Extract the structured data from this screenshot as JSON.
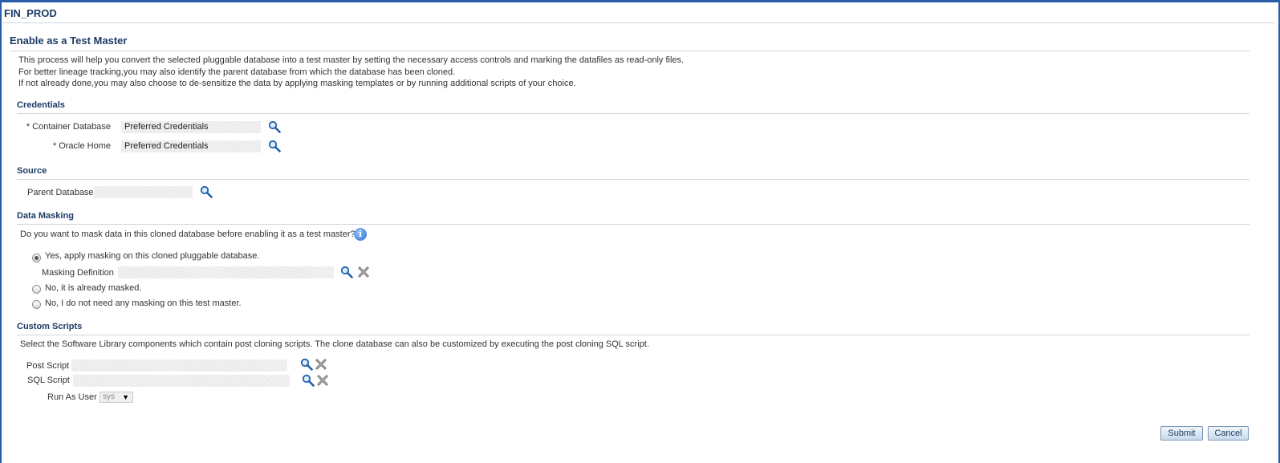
{
  "page": {
    "title": "FIN_PROD"
  },
  "section": {
    "heading": "Enable as a Test Master"
  },
  "intro": {
    "line1": "This process will help you convert the selected pluggable database into a test master by setting the necessary access controls and marking the datafiles as read-only files.",
    "line2": "For better lineage tracking,you may also identify the parent database from which the database has been cloned.",
    "line3": "If not already done,you may also choose to de-sensitize the data by applying masking templates or by running additional scripts of your choice."
  },
  "credentials": {
    "heading": "Credentials",
    "container_label": "* Container Database",
    "container_value": "Preferred Credentials",
    "oracle_home_label": "* Oracle Home",
    "oracle_home_value": "Preferred Credentials"
  },
  "source": {
    "heading": "Source",
    "parent_label": "Parent Database",
    "parent_value": ""
  },
  "masking": {
    "heading": "Data Masking",
    "question": "Do you want to mask data in this cloned database before enabling it as a test master?",
    "option_yes": "Yes, apply masking on this cloned pluggable database.",
    "definition_label": "Masking Definition",
    "definition_value": "",
    "option_already": "No, it is already masked.",
    "option_none": "No, I do not need any masking on this test master.",
    "selected": "yes"
  },
  "scripts": {
    "heading": "Custom Scripts",
    "description": "Select the Software Library components which contain post cloning scripts. The clone database can also be customized by executing the post cloning SQL script.",
    "post_label": "Post Script",
    "post_value": "",
    "sql_label": "SQL Script",
    "sql_value": "",
    "run_as_label": "Run As User",
    "run_as_value": "sys"
  },
  "buttons": {
    "submit": "Submit",
    "cancel": "Cancel"
  },
  "icons": {
    "search": "search-icon",
    "clear": "clear-icon",
    "info": "info-icon",
    "dropdown": "chevron-down-icon"
  },
  "colors": {
    "accent": "#2a5ea8",
    "heading": "#1c3b66",
    "rule": "#cfd6de"
  }
}
